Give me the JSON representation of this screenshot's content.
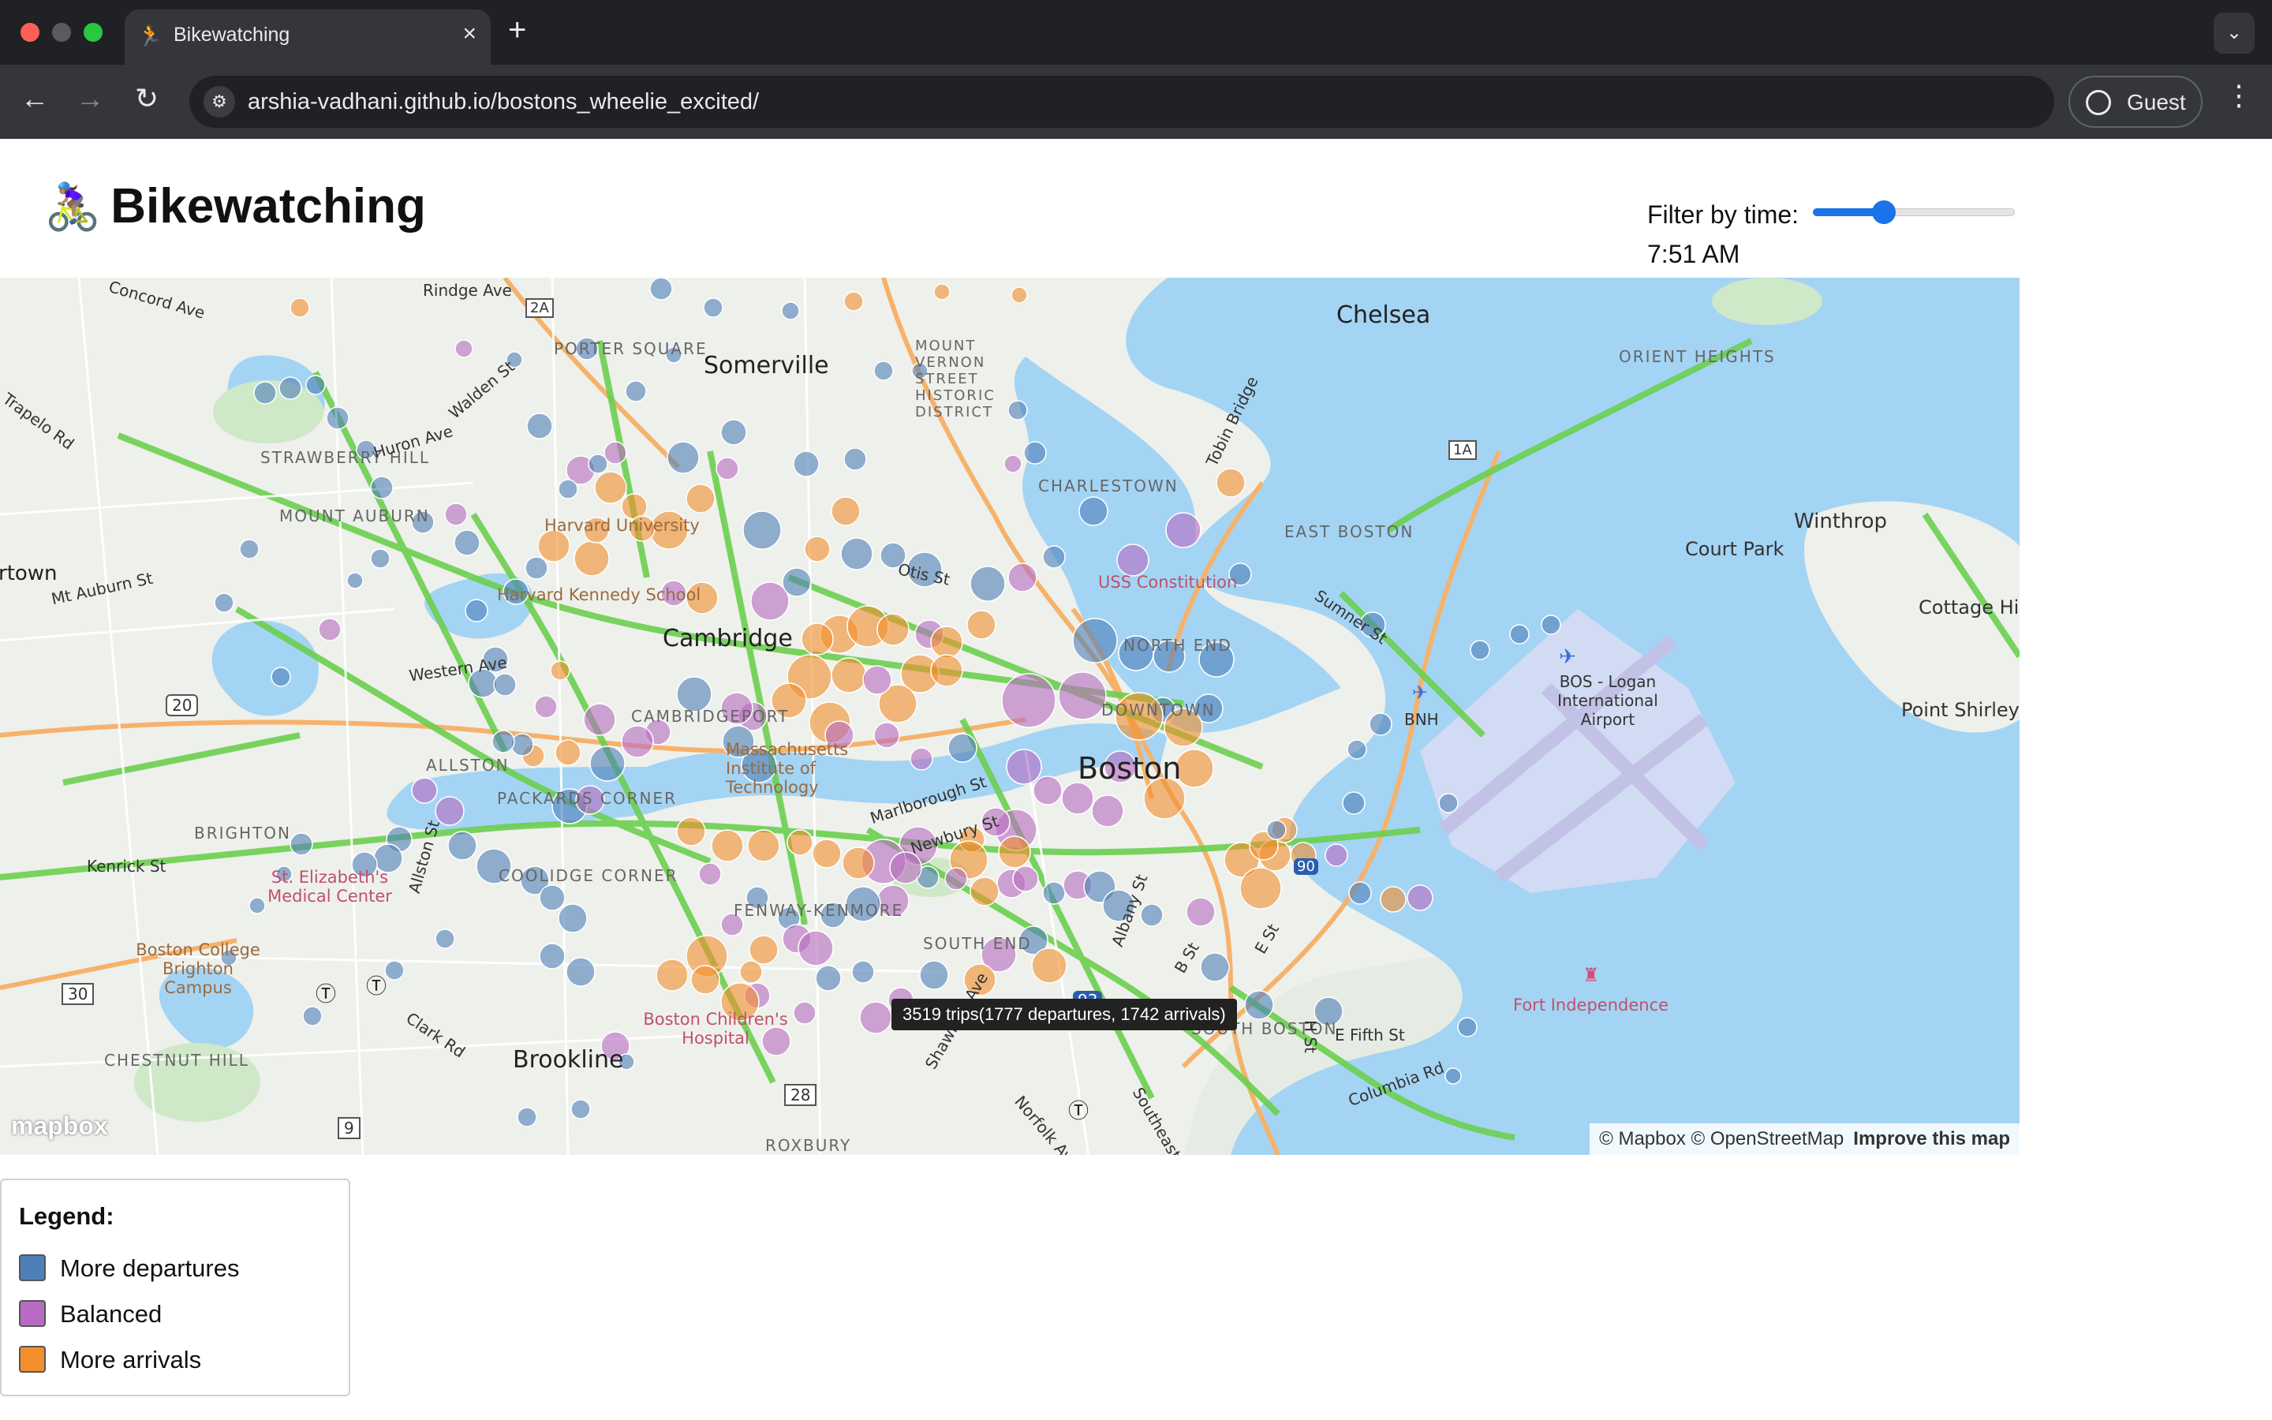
{
  "browser": {
    "tab_title": "Bikewatching",
    "tab_icon": "cyclist-favicon",
    "url": "arshia-vadhani.github.io/bostons_wheelie_excited/",
    "profile_label": "Guest"
  },
  "header": {
    "emoji": "🚴🏽‍♀️",
    "title": "Bikewatching",
    "filter_label": "Filter by time:",
    "time_value": "7:51 AM",
    "slider_fraction": 0.35
  },
  "map": {
    "tooltip": "3519 trips(1777 departures, 1742 arrivals)",
    "attribution": "© Mapbox © OpenStreetMap",
    "improve_link": "Improve this map",
    "logo_text": "mapbox",
    "places": [
      "Somerville",
      "Chelsea",
      "Cambridge",
      "Boston",
      "Brookline",
      "Winthrop",
      "Court Park",
      "Cottage Hill",
      "Point Shirley",
      "CHARLESTOWN",
      "EAST BOSTON",
      "ALLSTON",
      "BRIGHTON",
      "SOUTH BOSTON",
      "CHESTNUT HILL",
      "ROXBURY",
      "CAMBRIDGEPORT",
      "FENWAY-KENMORE",
      "SOUTH END",
      "ORIENT HEIGHTS",
      "MOUNT VERNON STREET HISTORIC DISTRICT",
      "STRAWBERRY HILL",
      "MOUNT AUBURN",
      "NORTH END",
      "DOWNTOWN",
      "COOLIDGE CORNER",
      "PACKARDS CORNER",
      "PORTER SQUARE",
      "Harvard University",
      "Harvard Kennedy School",
      "Massachusetts Institute of Technology",
      "USS Constitution",
      "BOS - Logan International Airport",
      "BNH",
      "St. Elizabeth's Medical Center",
      "Boston College Brighton Campus",
      "Boston Children's Hospital",
      "Fort Independence",
      "rtown",
      "Concord Ave",
      "Rindge Ave",
      "Walden St",
      "Huron Ave",
      "Trapelo Rd",
      "Mt Auburn St",
      "Western Ave",
      "Kenrick St",
      "Allston St",
      "Clark Rd",
      "Marlborough St",
      "Newbury St",
      "Tobin Bridge",
      "Sumner St",
      "E Fifth St",
      "Columbia Rd",
      "Norfolk Ave",
      "Southeast",
      "B St",
      "E St",
      "H St",
      "Albany St",
      "Otis St",
      "Shawmut Ave",
      "20",
      "30",
      "9",
      "28",
      "93",
      "90",
      "1A",
      "2A"
    ],
    "flow_colors": {
      "departures": "#4e7fb8",
      "balanced": "#b86bc2",
      "arrivals": "#f28e2b"
    }
  },
  "legend": {
    "title": "Legend:",
    "items": [
      {
        "label": "More departures",
        "color": "#4e7fb8"
      },
      {
        "label": "Balanced",
        "color": "#b86bc2"
      },
      {
        "label": "More arrivals",
        "color": "#f28e2b"
      }
    ]
  }
}
